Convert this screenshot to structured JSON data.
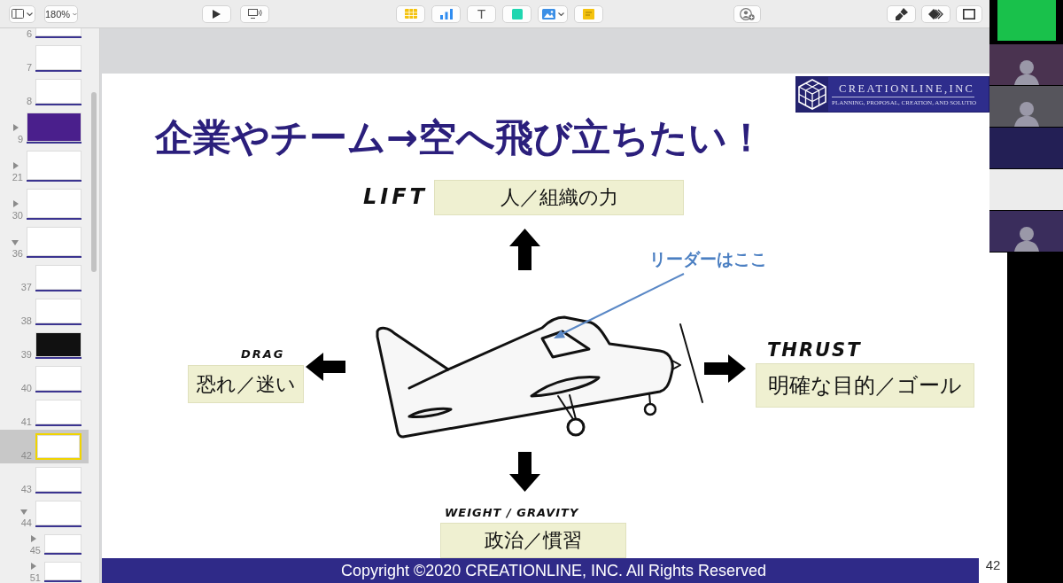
{
  "toolbar": {
    "groups": [
      {
        "buttons": [
          {
            "kind": "view",
            "dropdown": true
          },
          {
            "kind": "zoom",
            "label": "180%",
            "dropdown": true
          }
        ]
      },
      {
        "buttons": [
          {
            "kind": "play"
          },
          {
            "kind": "live"
          }
        ]
      },
      {
        "buttons": [
          {
            "kind": "table"
          },
          {
            "kind": "chart"
          },
          {
            "kind": "text",
            "label": "T"
          },
          {
            "kind": "shape"
          },
          {
            "kind": "media",
            "dropdown": true
          },
          {
            "kind": "comment"
          }
        ]
      },
      {
        "buttons": [
          {
            "kind": "collaborate"
          }
        ]
      },
      {
        "buttons": [
          {
            "kind": "format"
          },
          {
            "kind": "animate"
          },
          {
            "kind": "document"
          }
        ]
      }
    ]
  },
  "sidebar": {
    "slides": [
      {
        "children": [
          {
            "number": "6",
            "selected": false,
            "color": "#ffffff"
          },
          {
            "number": "7",
            "selected": false,
            "color": "#ffffff"
          },
          {
            "number": "8",
            "selected": false,
            "color": "#ffffff"
          }
        ]
      },
      {
        "number": "9",
        "expanded": false,
        "selected": false,
        "color": "#4a1f8c"
      },
      {
        "number": "21",
        "expanded": false,
        "selected": false,
        "color": "#ffffff"
      },
      {
        "number": "30",
        "expanded": false,
        "selected": false,
        "color": "#ffffff"
      },
      {
        "number": "36",
        "expanded": true,
        "selected": false,
        "color": "#ffffff",
        "children": [
          {
            "number": "37",
            "selected": false,
            "color": "#ffffff"
          },
          {
            "number": "38",
            "selected": false,
            "color": "#ffffff"
          },
          {
            "number": "39",
            "selected": false,
            "color": "#111111"
          },
          {
            "number": "40",
            "selected": false,
            "color": "#ffffff"
          },
          {
            "number": "41",
            "selected": false,
            "color": "#ffffff"
          },
          {
            "number": "42",
            "selected": true,
            "color": "#ffffff"
          },
          {
            "number": "43",
            "selected": false,
            "color": "#ffffff"
          },
          {
            "number": "44",
            "expanded": true,
            "selected": false,
            "color": "#ffffff",
            "children": [
              {
                "number": "45",
                "expanded": false,
                "selected": false,
                "color": "#ffffff"
              },
              {
                "number": "51",
                "expanded": false,
                "selected": false,
                "color": "#ffffff"
              }
            ]
          }
        ]
      }
    ]
  },
  "slide": {
    "logo": {
      "name": "CREATIONLINE,INC",
      "tagline": "PLANNING, PROPOSAL, CREATION, AND SOLUTIO"
    },
    "title": "企業やチーム→空へ飛び立ちたい！",
    "forces": [
      {
        "kind": "lift",
        "label": "LIFT",
        "text": "人／組織の力"
      },
      {
        "kind": "drag",
        "label": "DRAG",
        "text": "恐れ／迷い"
      },
      {
        "kind": "thrust",
        "label": "THRUST",
        "text": "明確な目的／ゴール"
      },
      {
        "kind": "weight",
        "label": "WEIGHT / GRAVITY",
        "text": "政治／慣習"
      }
    ],
    "callout": "リーダーはここ",
    "footer": "Copyright ©2020 CREATIONLINE, INC. All Rights Reserved",
    "page_number": "42"
  },
  "video_panel": {
    "tiles": [
      {
        "kind": "thumbnail",
        "color": "#19c14b"
      },
      {
        "kind": "camera",
        "color": "#4a3350"
      },
      {
        "kind": "camera",
        "color": "#56555c"
      },
      {
        "kind": "screen",
        "color": "#231f55"
      },
      {
        "kind": "screen",
        "color": "#ececec"
      },
      {
        "kind": "camera",
        "color": "#3a2d5c"
      }
    ]
  }
}
